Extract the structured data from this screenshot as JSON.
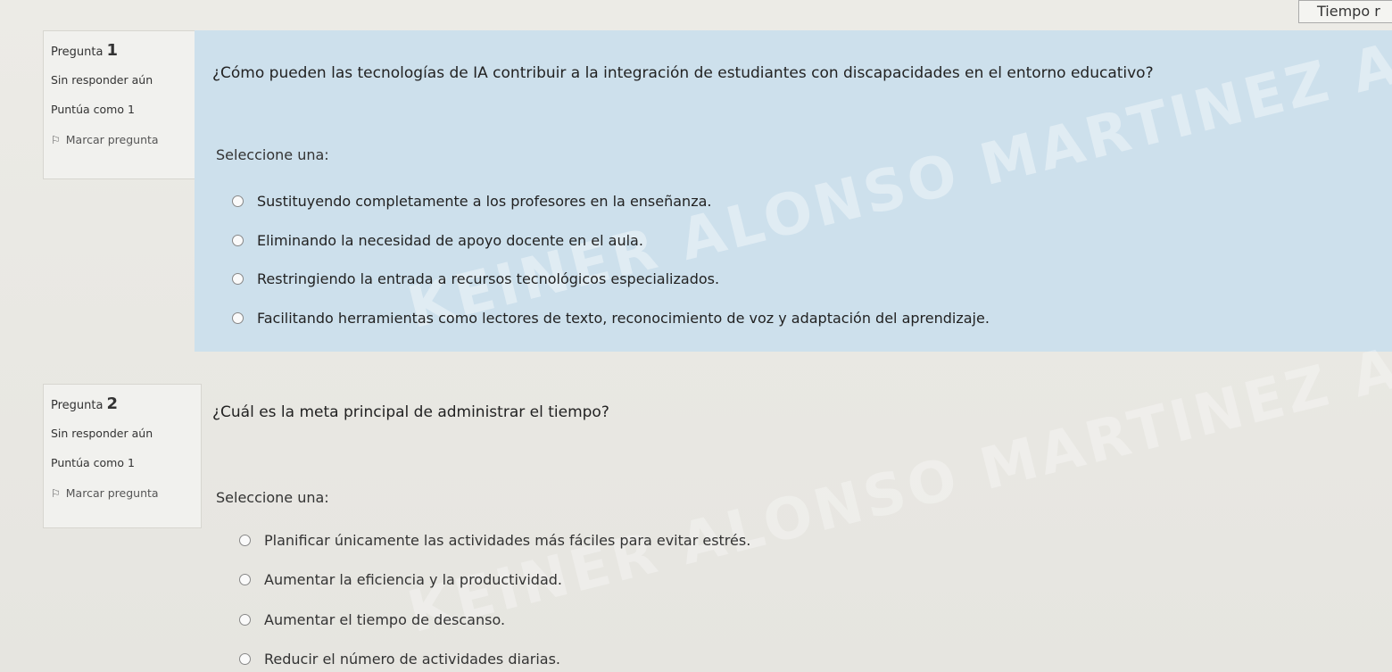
{
  "timer": {
    "label": "Tiempo r"
  },
  "questions": [
    {
      "number_prefix": "Pregunta",
      "number": "1",
      "state": "Sin responder aún",
      "points": "Puntúa como 1",
      "flag_label": "Marcar pregunta",
      "text": "¿Cómo pueden las tecnologías de IA contribuir a la integración de estudiantes con discapacidades en el entorno educativo?",
      "prompt": "Seleccione una:",
      "answers": [
        "Sustituyendo completamente a los profesores en la enseñanza.",
        "Eliminando la necesidad de apoyo docente en el aula.",
        "Restringiendo la entrada a recursos tecnológicos especializados.",
        "Facilitando herramientas como lectores de texto, reconocimiento de voz y adaptación del aprendizaje."
      ],
      "watermark": "KEINER ALONSO MARTINEZ ALFON"
    },
    {
      "number_prefix": "Pregunta",
      "number": "2",
      "state": "Sin responder aún",
      "points": "Puntúa como 1",
      "flag_label": "Marcar pregunta",
      "text": "¿Cuál es la meta principal de administrar el tiempo?",
      "prompt": "Seleccione una:",
      "answers": [
        "Planificar únicamente las actividades más fáciles para evitar estrés.",
        "Aumentar la eficiencia y la productividad.",
        "Aumentar el tiempo de descanso.",
        "Reducir el número de actividades diarias."
      ],
      "watermark": "KEINER ALONSO MARTINEZ ALFON"
    }
  ],
  "icons": {
    "flag": "flag-icon",
    "radio": "radio-icon"
  },
  "colors": {
    "question_bg": "#cde0ec",
    "info_bg": "#f1f1ee"
  }
}
